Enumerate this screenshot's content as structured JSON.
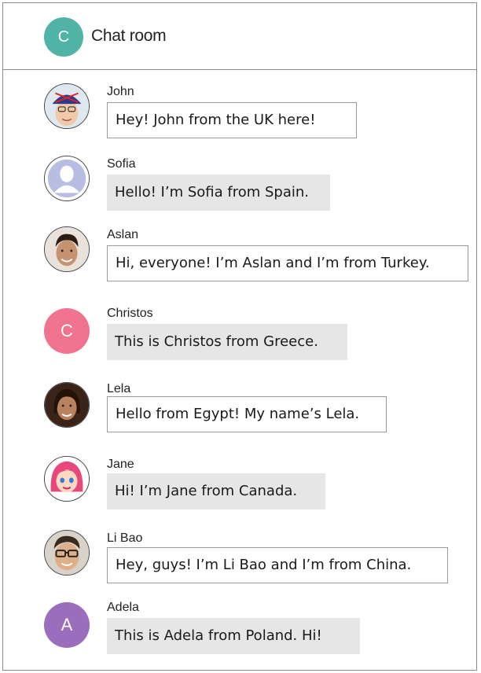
{
  "header": {
    "title": "Chat room",
    "avatar_letter": "C",
    "avatar_color": "#4fb3a5"
  },
  "messages": [
    {
      "name": "John",
      "text": "Hey! John from the UK here!",
      "avatar": "photo",
      "style": "outlined"
    },
    {
      "name": "Sofia",
      "text": "Hello! I’m Sofia from Spain.",
      "avatar": "default-user",
      "style": "filled"
    },
    {
      "name": "Aslan",
      "text": "Hi, everyone! I’m Aslan and I’m from Turkey.",
      "avatar": "photo",
      "style": "outlined"
    },
    {
      "name": "Christos",
      "text": "This is Christos from Greece.",
      "avatar_letter": "C",
      "avatar_color": "#f07390",
      "style": "filled"
    },
    {
      "name": "Lela",
      "text": "Hello from Egypt! My name’s Lela.",
      "avatar": "photo",
      "style": "outlined"
    },
    {
      "name": "Jane",
      "text": "Hi! I’m Jane from Canada.",
      "avatar": "cartoon",
      "style": "filled"
    },
    {
      "name": "Li Bao",
      "text": "Hey, guys! I’m Li Bao and I’m from China.",
      "avatar": "photo",
      "style": "outlined"
    },
    {
      "name": "Adela",
      "text": "This is Adela from Poland. Hi!",
      "avatar_letter": "A",
      "avatar_color": "#9b6dbd",
      "style": "filled"
    }
  ]
}
